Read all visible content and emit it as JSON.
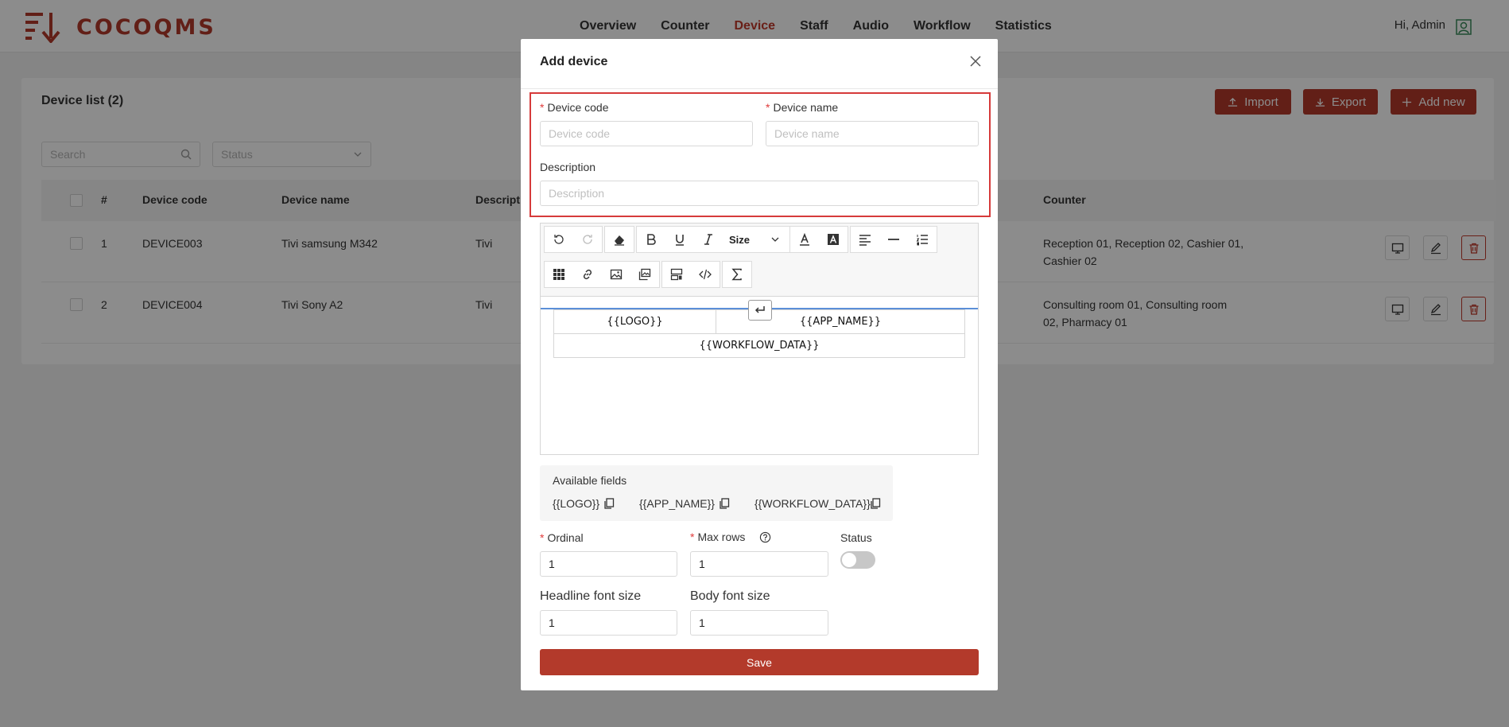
{
  "header": {
    "logo_text": "COCOQMS",
    "nav": [
      "Overview",
      "Counter",
      "Device",
      "Staff",
      "Audio",
      "Workflow",
      "Statistics"
    ],
    "active_nav": "Device",
    "greeting": "Hi, Admin"
  },
  "device_list": {
    "title": "Device list (2)",
    "buttons": {
      "import": "Import",
      "export": "Export",
      "add_new": "Add new"
    },
    "search_placeholder": "Search",
    "status_placeholder": "Status",
    "columns": [
      "#",
      "Device code",
      "Device name",
      "Description",
      "Counter"
    ],
    "rows": [
      {
        "index": "1",
        "code": "DEVICE003",
        "name": "Tivi samsung M342",
        "description": "Tivi",
        "counter_line1": "Reception 01, Reception 02, Cashier 01,",
        "counter_line2": "Cashier 02"
      },
      {
        "index": "2",
        "code": "DEVICE004",
        "name": "Tivi Sony A2",
        "description": "Tivi",
        "counter_line1": "Consulting room 01, Consulting room",
        "counter_line2": "02, Pharmacy 01"
      }
    ]
  },
  "modal": {
    "title": "Add device",
    "device_code_label": "Device code",
    "device_code_placeholder": "Device code",
    "device_name_label": "Device name",
    "device_name_placeholder": "Device name",
    "description_label": "Description",
    "description_placeholder": "Description",
    "toolbar_size_label": "Size",
    "editor": {
      "logo": "{{LOGO}}",
      "app_name": "{{APP_NAME}}",
      "workflow_data": "{{WORKFLOW_DATA}}"
    },
    "available_fields_title": "Available fields",
    "available_fields": [
      "{{LOGO}}",
      "{{APP_NAME}}",
      "{{WORKFLOW_DATA}}"
    ],
    "ordinal_label": "Ordinal",
    "ordinal_value": "1",
    "max_rows_label": "Max rows",
    "max_rows_value": "1",
    "status_label": "Status",
    "status_on": false,
    "headline_font_label": "Headline font size",
    "headline_font_value": "1",
    "body_font_label": "Body font size",
    "body_font_value": "1",
    "save_label": "Save"
  },
  "colors": {
    "brand": "#b33a2b",
    "required": "#e03b3b",
    "highlight": "#d63a3a"
  }
}
